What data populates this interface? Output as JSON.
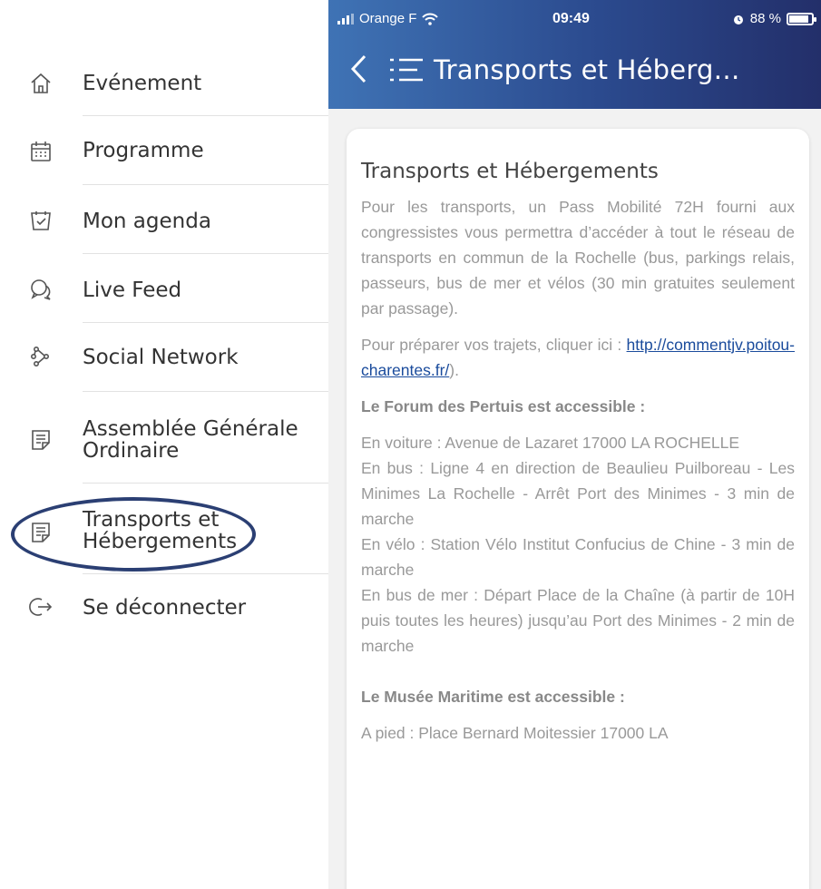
{
  "sidebar": {
    "items": [
      {
        "label": "Evénement",
        "icon": "home-icon"
      },
      {
        "label": "Programme",
        "icon": "calendar-grid-icon"
      },
      {
        "label": "Mon agenda",
        "icon": "agenda-icon"
      },
      {
        "label": "Live Feed",
        "icon": "chat-bubbles-icon"
      },
      {
        "label": "Social Network",
        "icon": "social-network-icon"
      },
      {
        "label": "Assemblée Générale\nOrdinaire",
        "icon": "document-icon"
      },
      {
        "label": "Transports et\nHébergements",
        "icon": "document-icon",
        "highlighted": true
      },
      {
        "label": "Se déconnecter",
        "icon": "logout-icon"
      }
    ],
    "highlight_color": "#2b3f73"
  },
  "status_bar": {
    "carrier": "Orange F",
    "time": "09:49",
    "battery": "88 %",
    "battery_level": 0.88
  },
  "header": {
    "title": "Transports et Héberg…",
    "gradient_start": "#3f73b5",
    "gradient_end": "#232f6a"
  },
  "content": {
    "title": "Transports et Hébergements",
    "para1": "Pour les transports, un Pass Mobilité 72H fourni aux congressistes vous permettra d’accéder à tout le réseau de transports en commun de la Rochelle (bus, parkings relais, passeurs, bus de mer et vélos (30 min gratuites seulement par passage).",
    "para2_prefix": "Pour préparer vos trajets, cliquer ici : ",
    "link": "http://commentjv.poitou-charentes.fr/",
    "para2_suffix": ").",
    "forum_heading": "Le Forum des Pertuis est accessible :",
    "forum_lines": [
      "En voiture : Avenue de Lazaret 17000 LA ROCHELLE",
      "En bus : Ligne 4 en direction de Beaulieu Puilboreau - Les Minimes La Rochelle - Arrêt Port des Minimes - 3 min de marche",
      "En vélo : Station Vélo Institut Confucius de Chine - 3 min de marche",
      "En bus de mer : Départ Place de la Chaîne (à partir de 10H puis toutes les heures) jusqu’au Port des Minimes - 2 min de marche"
    ],
    "musee_heading": "Le Musée Maritime est accessible :",
    "musee_line": "A pied : Place Bernard Moitessier 17000 LA"
  }
}
